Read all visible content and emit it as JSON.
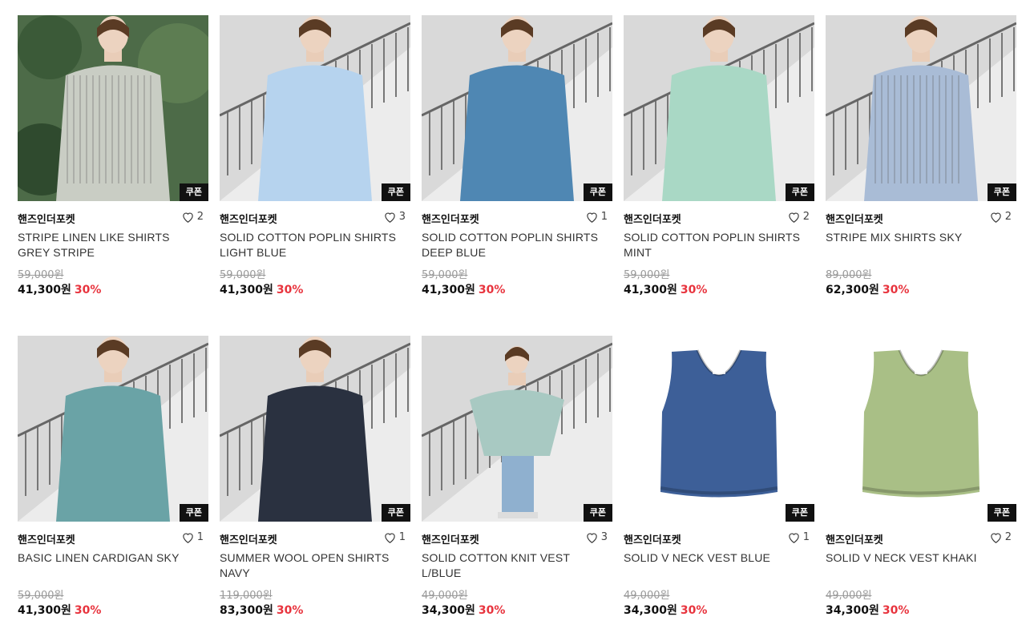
{
  "products": [
    {
      "brand": "핸즈인더포켓",
      "likes": "2",
      "name": "STRIPE LINEN LIKE SHIRTS GREY STRIPE",
      "original_price": "59,000원",
      "sale_price": "41,300원",
      "discount": "30%",
      "coupon": "쿠폰",
      "image": {
        "type": "model",
        "background": "#4d6b48",
        "garment": "#c9cdc4",
        "bottom": "#a89a7c",
        "stripe": true
      }
    },
    {
      "brand": "핸즈인더포켓",
      "likes": "3",
      "name": "SOLID COTTON POPLIN SHIRTS LIGHT BLUE",
      "original_price": "59,000원",
      "sale_price": "41,300원",
      "discount": "30%",
      "coupon": "쿠폰",
      "image": {
        "type": "model",
        "background": "#d9d9d9",
        "garment": "#b6d3ee",
        "bottom": "#2b2b2b",
        "stripe": false
      }
    },
    {
      "brand": "핸즈인더포켓",
      "likes": "1",
      "name": "SOLID COTTON POPLIN SHIRTS DEEP BLUE",
      "original_price": "59,000원",
      "sale_price": "41,300원",
      "discount": "30%",
      "coupon": "쿠폰",
      "image": {
        "type": "model",
        "background": "#d9d9d9",
        "garment": "#4f87b3",
        "bottom": "#3a3a3a",
        "stripe": false
      }
    },
    {
      "brand": "핸즈인더포켓",
      "likes": "2",
      "name": "SOLID COTTON POPLIN SHIRTS MINT",
      "original_price": "59,000원",
      "sale_price": "41,300원",
      "discount": "30%",
      "coupon": "쿠폰",
      "image": {
        "type": "model",
        "background": "#d9d9d9",
        "garment": "#a9d8c5",
        "bottom": "#7b6a58",
        "stripe": false
      }
    },
    {
      "brand": "핸즈인더포켓",
      "likes": "2",
      "name": "STRIPE MIX SHIRTS SKY",
      "original_price": "89,000원",
      "sale_price": "62,300원",
      "discount": "30%",
      "coupon": "쿠폰",
      "image": {
        "type": "model",
        "background": "#d9d9d9",
        "garment": "#a9bcd6",
        "bottom": "#333333",
        "stripe": true
      }
    },
    {
      "brand": "핸즈인더포켓",
      "likes": "1",
      "name": "BASIC LINEN CARDIGAN SKY",
      "original_price": "59,000원",
      "sale_price": "41,300원",
      "discount": "30%",
      "coupon": "쿠폰",
      "image": {
        "type": "model",
        "background": "#d9d9d9",
        "garment": "#6aa3a6",
        "bottom": "#8f8a80",
        "stripe": false
      }
    },
    {
      "brand": "핸즈인더포켓",
      "likes": "1",
      "name": "SUMMER WOOL OPEN SHIRTS NAVY",
      "original_price": "119,000원",
      "sale_price": "83,300원",
      "discount": "30%",
      "coupon": "쿠폰",
      "image": {
        "type": "model",
        "background": "#d9d9d9",
        "garment": "#2a3140",
        "bottom": "#5d89ad",
        "stripe": false
      }
    },
    {
      "brand": "핸즈인더포켓",
      "likes": "3",
      "name": "SOLID COTTON KNIT VEST L/BLUE",
      "original_price": "49,000원",
      "sale_price": "34,300원",
      "discount": "30%",
      "coupon": "쿠폰",
      "image": {
        "type": "model-full",
        "background": "#d9d9d9",
        "garment": "#a8c9c2",
        "bottom": "#8fb0cf",
        "stripe": false
      }
    },
    {
      "brand": "핸즈인더포켓",
      "likes": "1",
      "name": "SOLID V NECK VEST BLUE",
      "original_price": "49,000원",
      "sale_price": "34,300원",
      "discount": "30%",
      "coupon": "쿠폰",
      "image": {
        "type": "vest",
        "background": "#ffffff",
        "garment": "#3d5f98"
      }
    },
    {
      "brand": "핸즈인더포켓",
      "likes": "2",
      "name": "SOLID V NECK VEST KHAKI",
      "original_price": "49,000원",
      "sale_price": "34,300원",
      "discount": "30%",
      "coupon": "쿠폰",
      "image": {
        "type": "vest",
        "background": "#ffffff",
        "garment": "#a9bf86"
      }
    }
  ],
  "colors": {
    "discount": "#e8343e",
    "coupon_bg": "#111111",
    "strike": "#999999"
  },
  "icons": {
    "like": "heart-outline-icon"
  }
}
